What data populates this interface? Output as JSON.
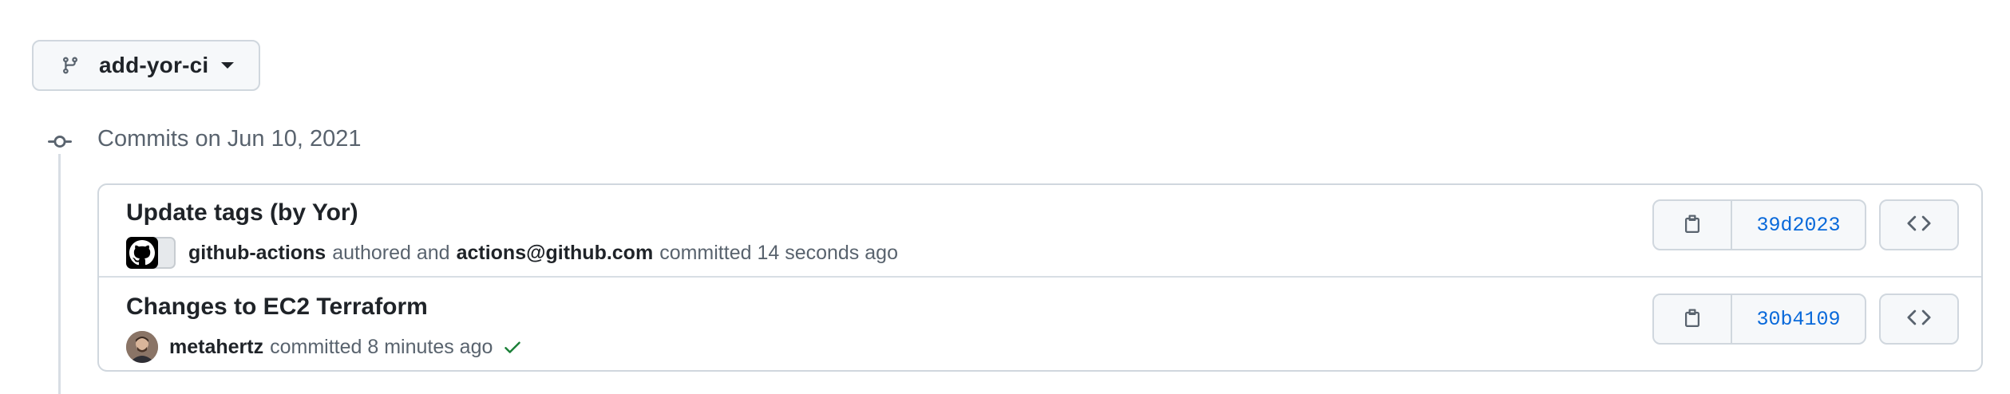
{
  "branch": {
    "name": "add-yor-ci",
    "icon": "git-branch-icon"
  },
  "group": {
    "title": "Commits on Jun 10, 2021",
    "icon": "git-commit-icon"
  },
  "commits": [
    {
      "title": "Update tags (by Yor)",
      "author": "github-actions",
      "authored_text": "authored and",
      "committer": "actions@github.com",
      "committed_text": "committed 14 seconds ago",
      "sha": "39d2023",
      "avatar": "github-mark-avatar",
      "status": ""
    },
    {
      "title": "Changes to EC2 Terraform",
      "author": "metahertz",
      "committed_text": "committed 8 minutes ago",
      "sha": "30b4109",
      "avatar": "user-avatar",
      "status": "check-icon"
    }
  ],
  "icons": {
    "copy": "clipboard-icon",
    "browse": "code-icon"
  },
  "colors": {
    "link": "#0969da",
    "success": "#1a7f37",
    "muted": "#59636e",
    "border": "#d0d7de"
  }
}
